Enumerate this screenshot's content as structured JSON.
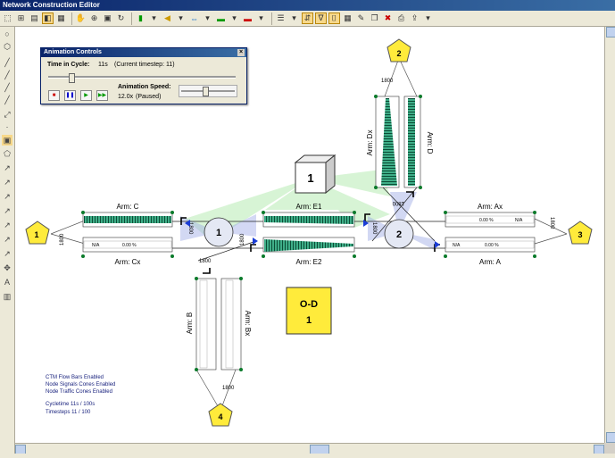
{
  "window": {
    "title": "Network Construction Editor"
  },
  "animation": {
    "title": "Animation Controls",
    "time_label": "Time in Cycle:",
    "time_value": "11s",
    "timestep_note": "(Current timestep: 11)",
    "speed_label": "Animation Speed:",
    "speed_value": "12.0x",
    "speed_state": "(Paused)",
    "time_fraction": 0.11,
    "speed_fraction": 0.45
  },
  "network": {
    "zones": [
      "1",
      "2",
      "3",
      "4"
    ],
    "nodes": [
      "1",
      "2"
    ],
    "signal_box": "1",
    "od": {
      "line1": "O-D",
      "line2": "1"
    },
    "arms": {
      "c": "Arm: C",
      "cx": "Arm: Cx",
      "e1": "Arm: E1",
      "e2": "Arm: E2",
      "ax": "Arm: Ax",
      "a": "Arm: A",
      "dx": "Arm: Dx",
      "d": "Arm: D",
      "b": "Arm: B",
      "bx": "Arm: Bx"
    },
    "capacity": "1800",
    "na": "N/A",
    "pct": "0.00 %"
  },
  "info": {
    "line1": "CTM Flow Bars Enabled",
    "line2": "Node Signals Cones Enabled",
    "line3": "Node Traffic Cones Enabled",
    "line4": "Cycletime 11s / 100s",
    "line5": "Timesteps 11 / 100"
  }
}
